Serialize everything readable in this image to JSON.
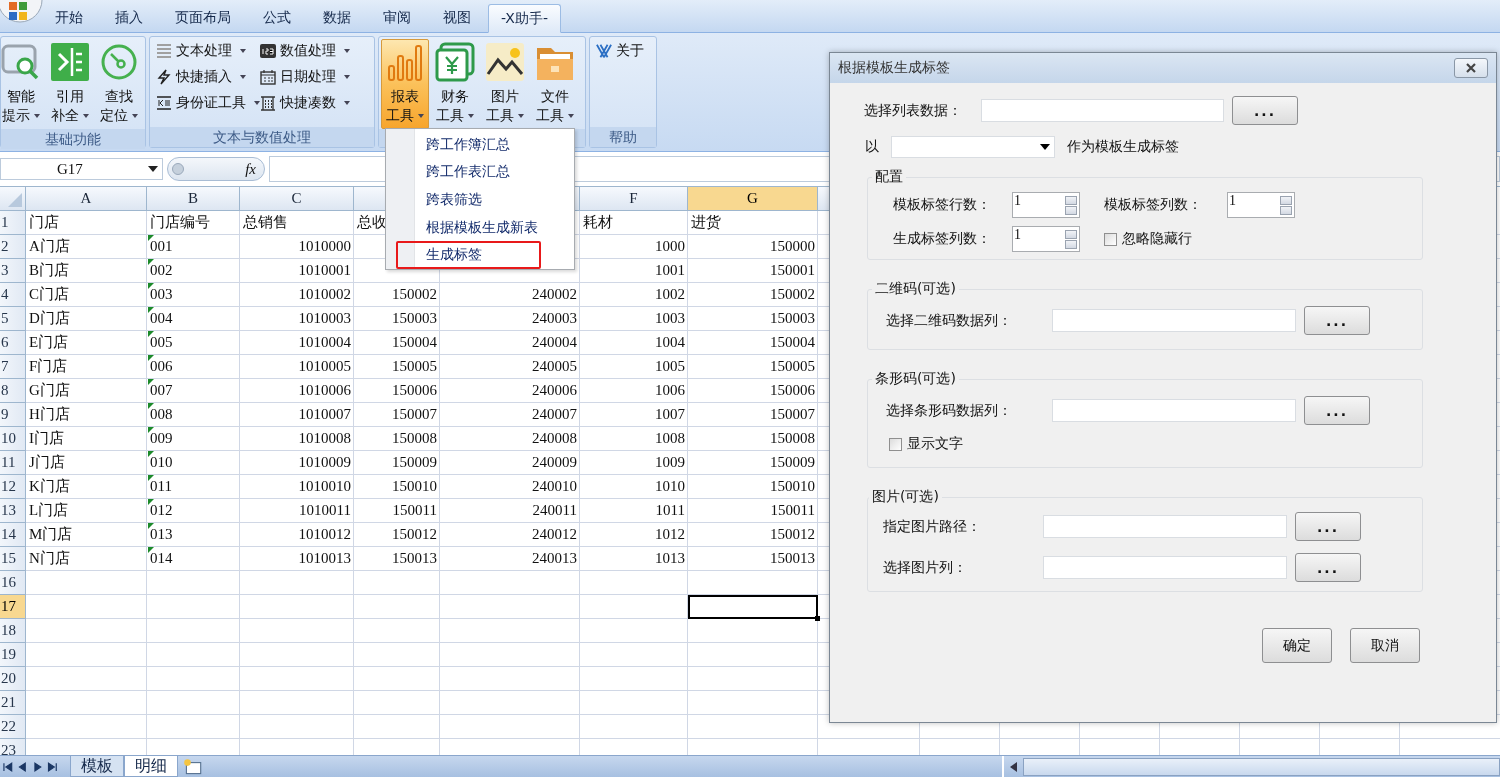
{
  "ribbon": {
    "tabs": [
      {
        "label": "开始",
        "selected": false
      },
      {
        "label": "插入",
        "selected": false
      },
      {
        "label": "页面布局",
        "selected": false
      },
      {
        "label": "公式",
        "selected": false
      },
      {
        "label": "数据",
        "selected": false
      },
      {
        "label": "审阅",
        "selected": false
      },
      {
        "label": "视图",
        "selected": false
      },
      {
        "label": "-X助手-",
        "selected": true
      }
    ],
    "groups": [
      {
        "label": "基础功能",
        "buttons": [
          {
            "kind": "large",
            "line1": "智能",
            "line2": "提示",
            "dropdown": true,
            "pressed": false
          },
          {
            "kind": "large",
            "line1": "引用",
            "line2": "补全",
            "dropdown": true,
            "pressed": false
          },
          {
            "kind": "large",
            "line1": "查找",
            "line2": "定位",
            "dropdown": true,
            "pressed": false
          }
        ]
      },
      {
        "label": "文本与数值处理",
        "buttons": [
          {
            "kind": "small",
            "label": "文本处理",
            "dropdown": true,
            "pressed": false
          },
          {
            "kind": "small",
            "label": "快捷插入",
            "dropdown": true,
            "pressed": false
          },
          {
            "kind": "small",
            "label": "身份证工具",
            "dropdown": true,
            "pressed": false
          },
          {
            "kind": "small",
            "label": "数值处理",
            "dropdown": true,
            "pressed": false
          },
          {
            "kind": "small",
            "label": "日期处理",
            "dropdown": true,
            "pressed": false
          },
          {
            "kind": "small",
            "label": "快捷凑数",
            "dropdown": true,
            "pressed": false
          }
        ]
      },
      {
        "buttons": [
          {
            "kind": "large",
            "line1": "报表",
            "line2": "工具",
            "dropdown": true,
            "pressed": true
          },
          {
            "kind": "large",
            "line1": "财务",
            "line2": "工具",
            "dropdown": true,
            "pressed": false
          },
          {
            "kind": "large",
            "line1": "图片",
            "line2": "工具",
            "dropdown": true,
            "pressed": false
          },
          {
            "kind": "large",
            "line1": "文件",
            "line2": "工具",
            "dropdown": true,
            "pressed": false
          }
        ]
      },
      {
        "label": "帮助",
        "buttons": [
          {
            "kind": "small",
            "label": "关于",
            "dropdown": false,
            "pressed": false
          }
        ]
      }
    ]
  },
  "menu": {
    "items": [
      {
        "label": "跨工作簿汇总",
        "highlighted": false
      },
      {
        "label": "跨工作表汇总",
        "highlighted": false
      },
      {
        "label": "跨表筛选",
        "highlighted": false
      },
      {
        "label": "根据模板生成新表",
        "highlighted": false
      },
      {
        "label": "生成标签",
        "highlighted": true
      }
    ]
  },
  "formula_bar": {
    "name_box": "G17",
    "function_button": "fx"
  },
  "sheet": {
    "columns": [
      {
        "label": "A",
        "selected": false
      },
      {
        "label": "B",
        "selected": false
      },
      {
        "label": "C",
        "selected": false
      },
      {
        "selected": false
      },
      {
        "selected": false
      },
      {
        "label": "F",
        "selected": false
      },
      {
        "label": "G",
        "selected": true
      }
    ],
    "rows": [
      {
        "number": "1",
        "selected": false,
        "text_flag": false,
        "cells": [
          "门店",
          "门店编号",
          "总销售",
          "总收",
          null,
          "耗材",
          "进货"
        ]
      },
      {
        "number": "2",
        "selected": false,
        "text_flag": true,
        "cells": [
          "A门店",
          "001",
          "1010000",
          null,
          null,
          "1000",
          "150000"
        ]
      },
      {
        "number": "3",
        "selected": false,
        "text_flag": true,
        "cells": [
          "B门店",
          "002",
          "1010001",
          null,
          null,
          "1001",
          "150001"
        ]
      },
      {
        "number": "4",
        "selected": false,
        "text_flag": true,
        "cells": [
          "C门店",
          "003",
          "1010002",
          "150002",
          "240002",
          "1002",
          "150002"
        ]
      },
      {
        "number": "5",
        "selected": false,
        "text_flag": true,
        "cells": [
          "D门店",
          "004",
          "1010003",
          "150003",
          "240003",
          "1003",
          "150003"
        ]
      },
      {
        "number": "6",
        "selected": false,
        "text_flag": true,
        "cells": [
          "E门店",
          "005",
          "1010004",
          "150004",
          "240004",
          "1004",
          "150004"
        ]
      },
      {
        "number": "7",
        "selected": false,
        "text_flag": true,
        "cells": [
          "F门店",
          "006",
          "1010005",
          "150005",
          "240005",
          "1005",
          "150005"
        ]
      },
      {
        "number": "8",
        "selected": false,
        "text_flag": true,
        "cells": [
          "G门店",
          "007",
          "1010006",
          "150006",
          "240006",
          "1006",
          "150006"
        ]
      },
      {
        "number": "9",
        "selected": false,
        "text_flag": true,
        "cells": [
          "H门店",
          "008",
          "1010007",
          "150007",
          "240007",
          "1007",
          "150007"
        ]
      },
      {
        "number": "10",
        "selected": false,
        "text_flag": true,
        "cells": [
          "I门店",
          "009",
          "1010008",
          "150008",
          "240008",
          "1008",
          "150008"
        ]
      },
      {
        "number": "11",
        "selected": false,
        "text_flag": true,
        "cells": [
          "J门店",
          "010",
          "1010009",
          "150009",
          "240009",
          "1009",
          "150009"
        ]
      },
      {
        "number": "12",
        "selected": false,
        "text_flag": true,
        "cells": [
          "K门店",
          "011",
          "1010010",
          "150010",
          "240010",
          "1010",
          "150010"
        ]
      },
      {
        "number": "13",
        "selected": false,
        "text_flag": true,
        "cells": [
          "L门店",
          "012",
          "1010011",
          "150011",
          "240011",
          "1011",
          "150011"
        ]
      },
      {
        "number": "14",
        "selected": false,
        "text_flag": true,
        "cells": [
          "M门店",
          "013",
          "1010012",
          "150012",
          "240012",
          "1012",
          "150012"
        ]
      },
      {
        "number": "15",
        "selected": false,
        "text_flag": true,
        "cells": [
          "N门店",
          "014",
          "1010013",
          "150013",
          "240013",
          "1013",
          "150013"
        ]
      },
      {
        "number": "16",
        "selected": false,
        "text_flag": false
      },
      {
        "number": "17",
        "selected": true,
        "text_flag": false
      },
      {
        "number": "18",
        "selected": false,
        "text_flag": false
      },
      {
        "number": "19",
        "selected": false,
        "text_flag": false
      },
      {
        "number": "20",
        "selected": false,
        "text_flag": false
      },
      {
        "number": "21",
        "selected": false,
        "text_flag": false
      },
      {
        "number": "22",
        "selected": false,
        "text_flag": false
      },
      {
        "number": "23",
        "selected": false,
        "text_flag": false
      }
    ]
  },
  "sheet_tabs": [
    {
      "label": "模板",
      "selected": false
    },
    {
      "label": "明细",
      "selected": true
    }
  ],
  "dialog": {
    "title": "根据模板生成标签",
    "source": {
      "label": "选择列表数据：",
      "browse": "..."
    },
    "template": {
      "prefix": "以",
      "suffix": "作为模板生成标签"
    },
    "config": {
      "legend": "配置",
      "row_count": {
        "label": "模板标签行数：",
        "value": "1"
      },
      "col_count": {
        "label": "模板标签列数：",
        "value": "1"
      },
      "out_cols": {
        "label": "生成标签列数：",
        "value": "1"
      },
      "ignore_hidden": {
        "label": "忽略隐藏行",
        "checked": false
      }
    },
    "qrcode": {
      "legend": "二维码(可选)",
      "field": {
        "label": "选择二维码数据列：",
        "browse": "..."
      }
    },
    "barcode": {
      "legend": "条形码(可选)",
      "field": {
        "label": "选择条形码数据列：",
        "browse": "..."
      },
      "show_text": {
        "label": "显示文字",
        "checked": false
      }
    },
    "picture": {
      "legend": "图片(可选)",
      "fields": [
        {
          "label": "指定图片路径：",
          "browse": "..."
        },
        {
          "label": "选择图片列：",
          "browse": "..."
        }
      ]
    },
    "buttons": [
      "确定",
      "取消"
    ]
  }
}
